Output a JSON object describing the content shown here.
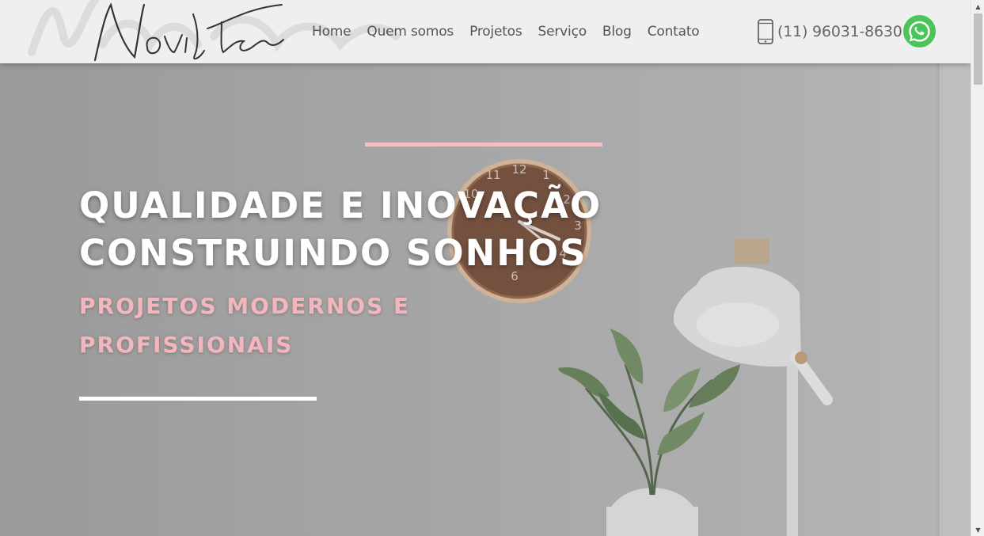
{
  "header": {
    "logo_text": "Noviltar",
    "nav": [
      {
        "label": "Home"
      },
      {
        "label": "Quem somos"
      },
      {
        "label": "Projetos"
      },
      {
        "label": "Serviço"
      },
      {
        "label": "Blog"
      },
      {
        "label": "Contato"
      }
    ],
    "phone": "(11) 96031-8630",
    "phone_icon": "mobile-phone-icon",
    "whatsapp_icon": "whatsapp-icon"
  },
  "hero": {
    "headline_line1": "QUALIDADE E INOVAÇÃO",
    "headline_line2": "CONSTRUINDO SONHOS",
    "subheadline": "PROJETOS MODERNOS E PROFISSIONAIS"
  },
  "colors": {
    "accent_pink": "#f2c0c5",
    "whatsapp_green": "#4bc45a",
    "header_bg": "#efefef",
    "nav_text": "#555555"
  }
}
